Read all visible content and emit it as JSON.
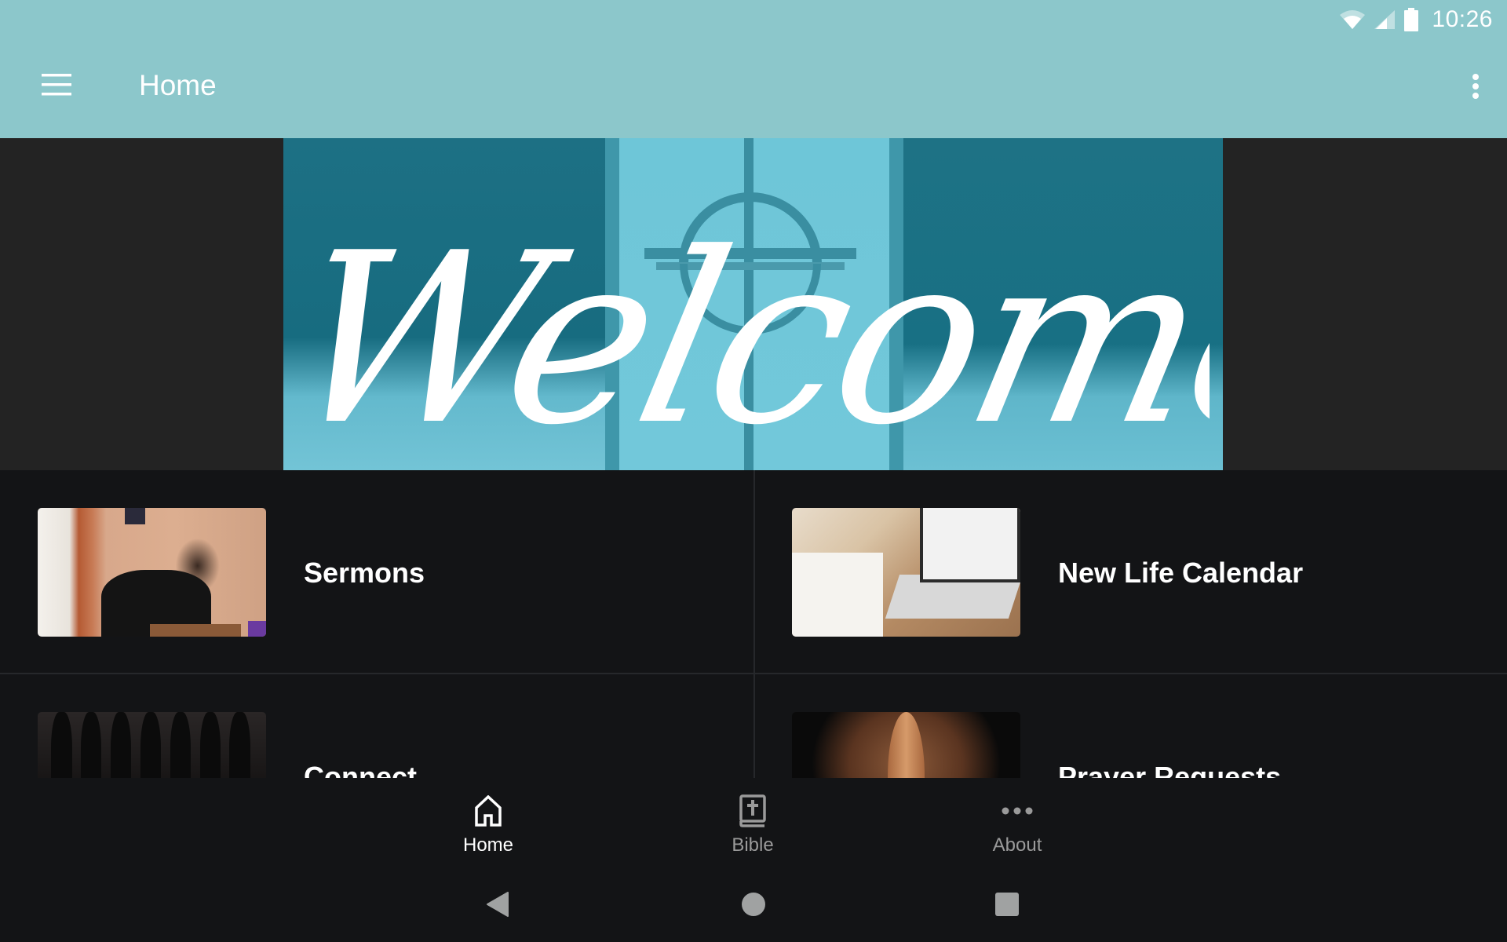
{
  "status_bar": {
    "time": "10:26",
    "icons": [
      "wifi-icon",
      "cellular-signal-icon",
      "battery-icon"
    ]
  },
  "app_bar": {
    "title": "Home",
    "menu_icon": "hamburger-menu-icon",
    "overflow_icon": "more-vert-icon",
    "background_color": "#8cc7cb"
  },
  "banner": {
    "text": "Welcome",
    "alt": "Welcome banner with church door and cross"
  },
  "tiles": [
    {
      "label": "Sermons",
      "image": "sermon preacher photo"
    },
    {
      "label": "New Life Calendar",
      "image": "laptop calendar photo"
    },
    {
      "label": "Connect",
      "image": "choir photo"
    },
    {
      "label": "Prayer Requests",
      "image": "praying hands photo"
    }
  ],
  "bottom_nav": {
    "items": [
      {
        "label": "Home",
        "icon": "home-icon",
        "active": true
      },
      {
        "label": "Bible",
        "icon": "bible-icon",
        "active": false
      },
      {
        "label": "About",
        "icon": "more-horiz-icon",
        "active": false
      }
    ],
    "active_color": "#ffffff",
    "inactive_color": "#9a9a9a"
  },
  "system_nav": {
    "buttons": [
      "back",
      "home",
      "recents"
    ]
  }
}
